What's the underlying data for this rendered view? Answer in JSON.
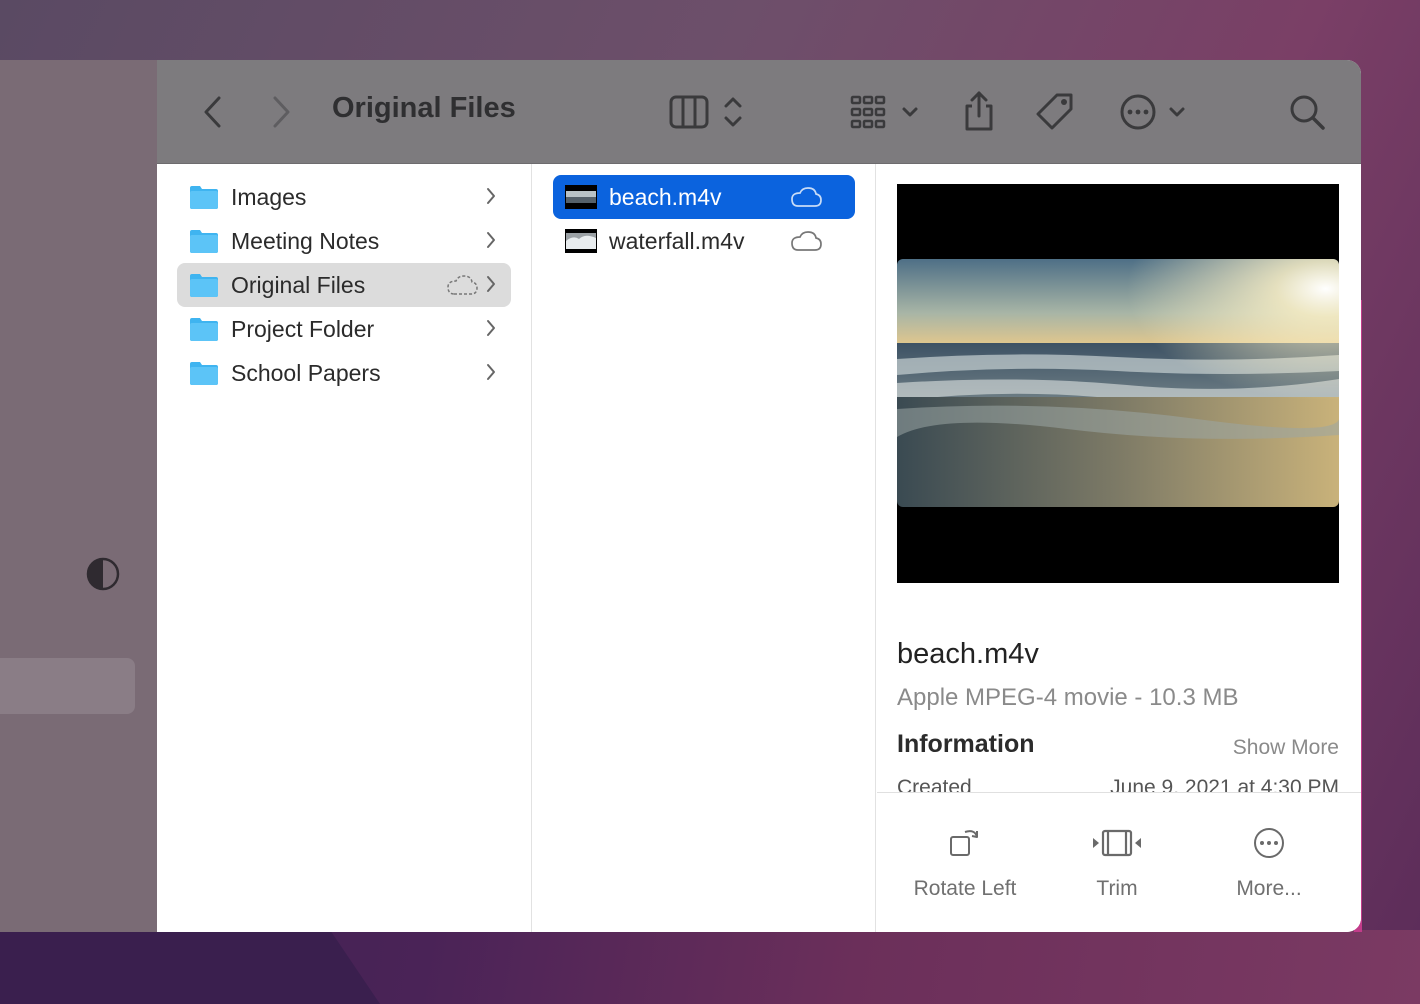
{
  "window": {
    "title": "Original Files"
  },
  "toolbar": {
    "back_icon": "chevron-left-icon",
    "forward_icon": "chevron-right-icon",
    "view_icon": "column-view-icon",
    "group_icon": "grid-group-icon",
    "share_icon": "share-icon",
    "tag_icon": "tag-icon",
    "more_icon": "ellipsis-circle-icon",
    "search_icon": "search-icon"
  },
  "column1": {
    "items": [
      {
        "label": "Images"
      },
      {
        "label": "Meeting Notes"
      },
      {
        "label": "Original Files"
      },
      {
        "label": "Project Folder"
      },
      {
        "label": "School Papers"
      }
    ]
  },
  "column2": {
    "items": [
      {
        "label": "beach.m4v"
      },
      {
        "label": "waterfall.m4v"
      }
    ]
  },
  "preview": {
    "file_name": "beach.m4v",
    "file_kind": "Apple MPEG-4 movie - 10.3 MB",
    "info_heading": "Information",
    "show_more": "Show More",
    "created_label": "Created",
    "created_value": "June 9, 2021 at 4:30 PM"
  },
  "actions": [
    {
      "label": "Rotate Left",
      "icon": "rotate-left-icon"
    },
    {
      "label": "Trim",
      "icon": "trim-icon"
    },
    {
      "label": "More...",
      "icon": "ellipsis-circle-icon"
    }
  ],
  "colors": {
    "selection_blue": "#0b63de",
    "folder_blue": "#3fb4f0"
  }
}
